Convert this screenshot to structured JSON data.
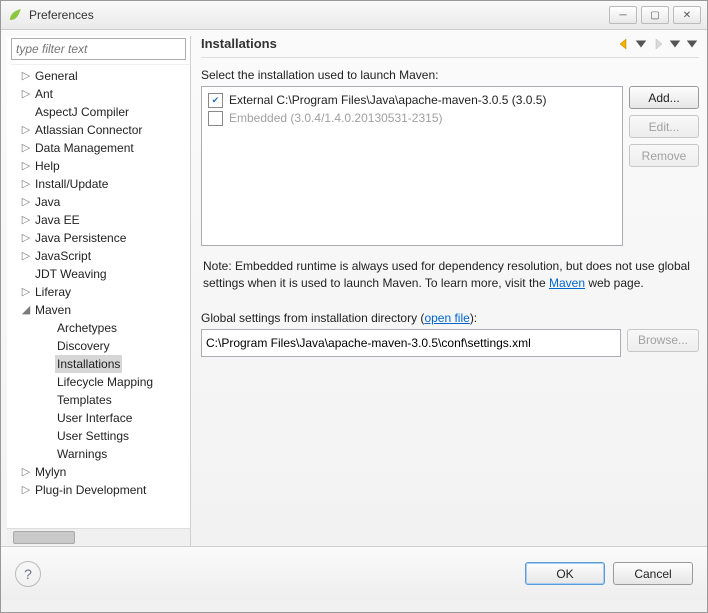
{
  "window": {
    "title": "Preferences"
  },
  "sidebar": {
    "filter_placeholder": "type filter text",
    "items": [
      {
        "label": "General",
        "level": 0,
        "arrow": "▷"
      },
      {
        "label": "Ant",
        "level": 0,
        "arrow": "▷"
      },
      {
        "label": "AspectJ Compiler",
        "level": 0,
        "arrow": ""
      },
      {
        "label": "Atlassian Connector",
        "level": 0,
        "arrow": "▷"
      },
      {
        "label": "Data Management",
        "level": 0,
        "arrow": "▷"
      },
      {
        "label": "Help",
        "level": 0,
        "arrow": "▷"
      },
      {
        "label": "Install/Update",
        "level": 0,
        "arrow": "▷"
      },
      {
        "label": "Java",
        "level": 0,
        "arrow": "▷"
      },
      {
        "label": "Java EE",
        "level": 0,
        "arrow": "▷"
      },
      {
        "label": "Java Persistence",
        "level": 0,
        "arrow": "▷"
      },
      {
        "label": "JavaScript",
        "level": 0,
        "arrow": "▷"
      },
      {
        "label": "JDT Weaving",
        "level": 0,
        "arrow": ""
      },
      {
        "label": "Liferay",
        "level": 0,
        "arrow": "▷"
      },
      {
        "label": "Maven",
        "level": 0,
        "arrow": "◢"
      },
      {
        "label": "Archetypes",
        "level": 1,
        "arrow": ""
      },
      {
        "label": "Discovery",
        "level": 1,
        "arrow": ""
      },
      {
        "label": "Installations",
        "level": 1,
        "arrow": "",
        "selected": true
      },
      {
        "label": "Lifecycle Mapping",
        "level": 1,
        "arrow": ""
      },
      {
        "label": "Templates",
        "level": 1,
        "arrow": ""
      },
      {
        "label": "User Interface",
        "level": 1,
        "arrow": ""
      },
      {
        "label": "User Settings",
        "level": 1,
        "arrow": ""
      },
      {
        "label": "Warnings",
        "level": 1,
        "arrow": ""
      },
      {
        "label": "Mylyn",
        "level": 0,
        "arrow": "▷"
      },
      {
        "label": "Plug-in Development",
        "level": 0,
        "arrow": "▷"
      }
    ]
  },
  "page": {
    "title": "Installations",
    "select_label": "Select the installation used to launch Maven:",
    "installations": [
      {
        "checked": true,
        "text": "External C:\\Program Files\\Java\\apache-maven-3.0.5 (3.0.5)"
      },
      {
        "checked": false,
        "text": "Embedded (3.0.4/1.4.0.20130531-2315)",
        "disabled": true
      }
    ],
    "buttons": {
      "add": "Add...",
      "edit": "Edit...",
      "remove": "Remove",
      "browse": "Browse..."
    },
    "note_prefix": "Note: Embedded runtime is always used for dependency resolution, but does not use global settings when it is used to launch Maven. To learn more, visit the ",
    "note_link": "Maven",
    "note_suffix": " web page.",
    "gs_label_prefix": "Global settings from installation directory (",
    "gs_open_file": "open file",
    "gs_label_suffix": "):",
    "gs_value": "C:\\Program Files\\Java\\apache-maven-3.0.5\\conf\\settings.xml"
  },
  "footer": {
    "ok": "OK",
    "cancel": "Cancel"
  }
}
